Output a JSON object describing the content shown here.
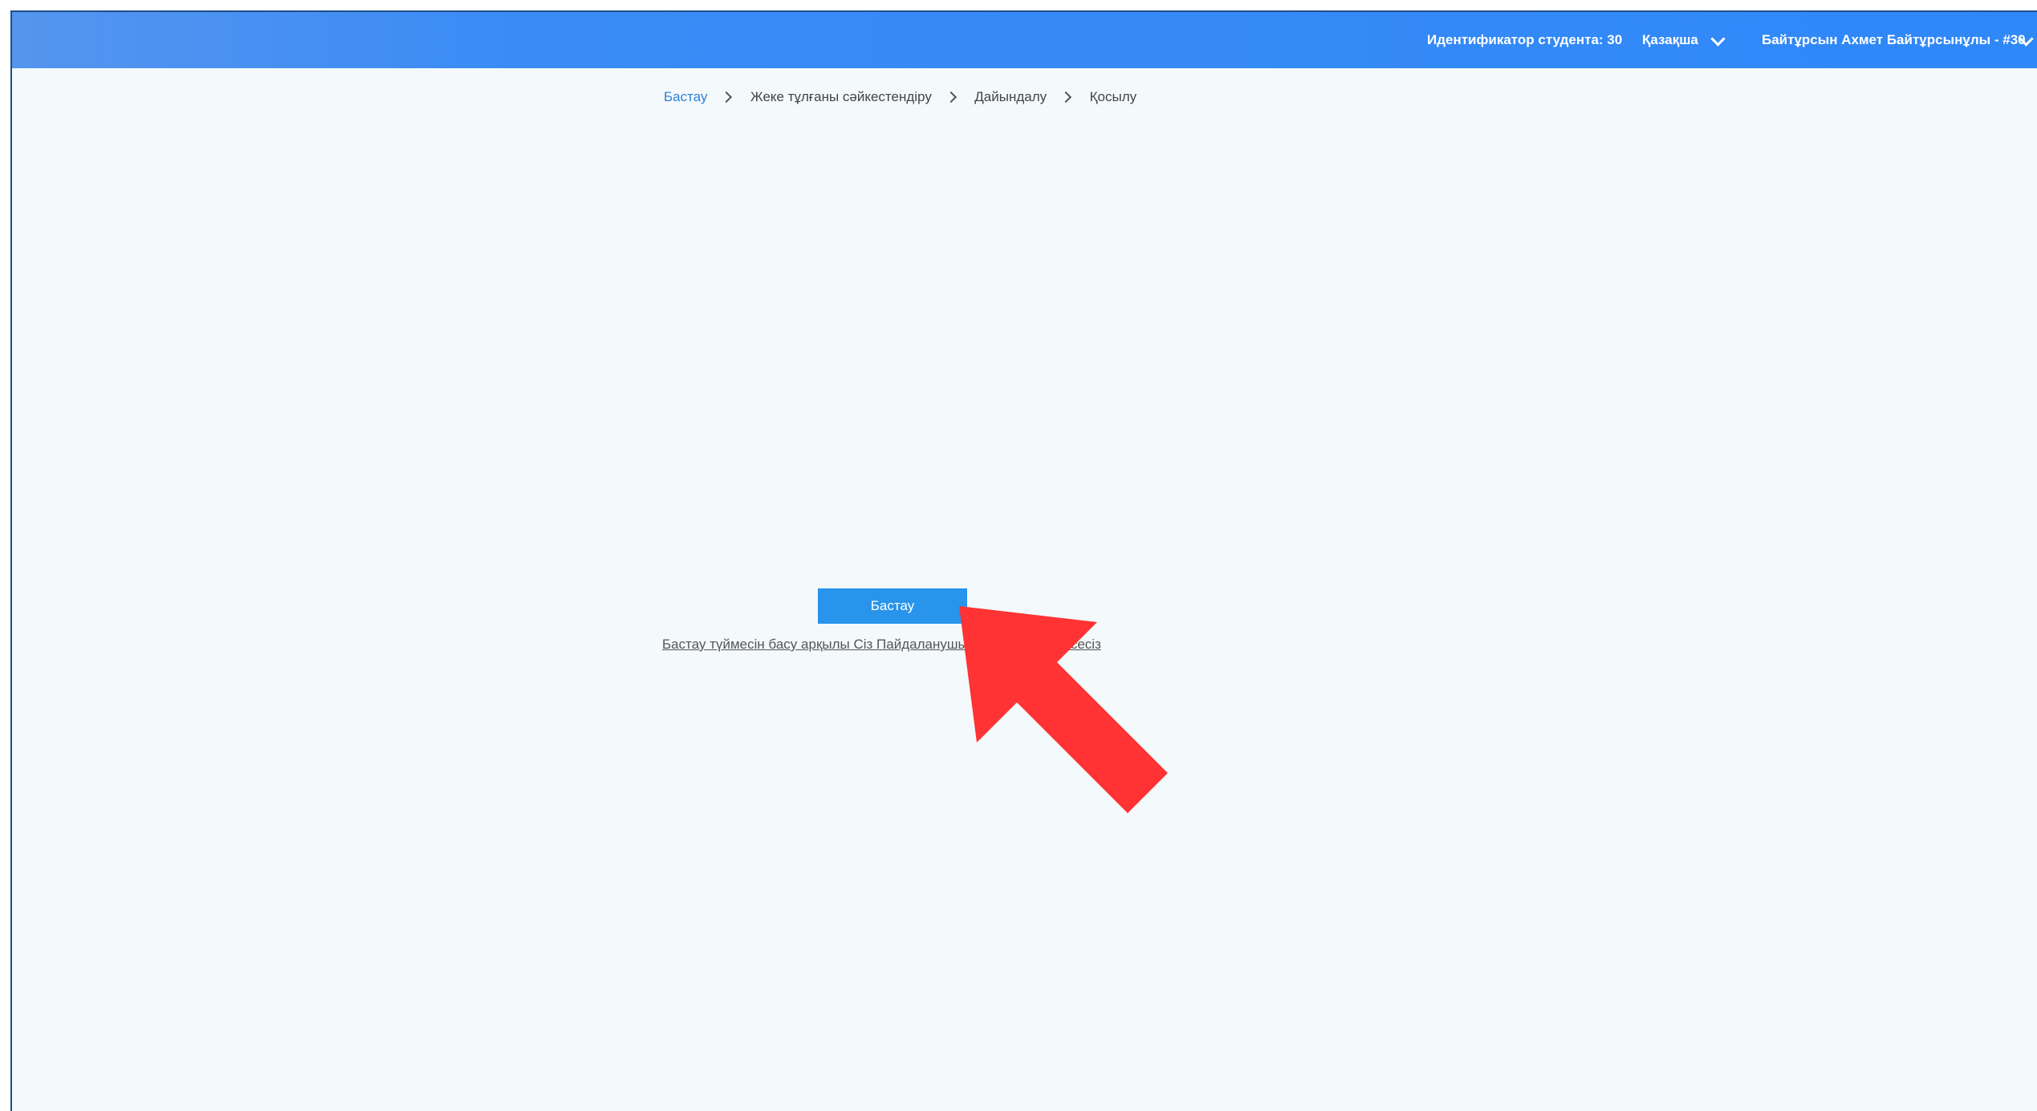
{
  "header": {
    "student_id": "Идентификатор студента: 30",
    "language": "Қазақша",
    "user": "Байтұрсын Ахмет Байтұрсынұлы - #30",
    "chevron_icon": "chevron-down-icon",
    "background_color": "#3a8bf6"
  },
  "breadcrumb": {
    "items": [
      "Бастау",
      "Жеке тұлғаны сәйкестендіру",
      "Дайындалу",
      "Қосылу"
    ],
    "separator_icon": "chevron-right-icon"
  },
  "main": {
    "start_button_label": "Бастау",
    "agreement_text": "Бастау түймесін басу арқылы Сіз Пайдаланушы келісімімен келісесіз",
    "button_color": "#2894ec"
  },
  "annotation": {
    "arrow_icon": "red-arrow-icon",
    "color": "#ff3333"
  }
}
